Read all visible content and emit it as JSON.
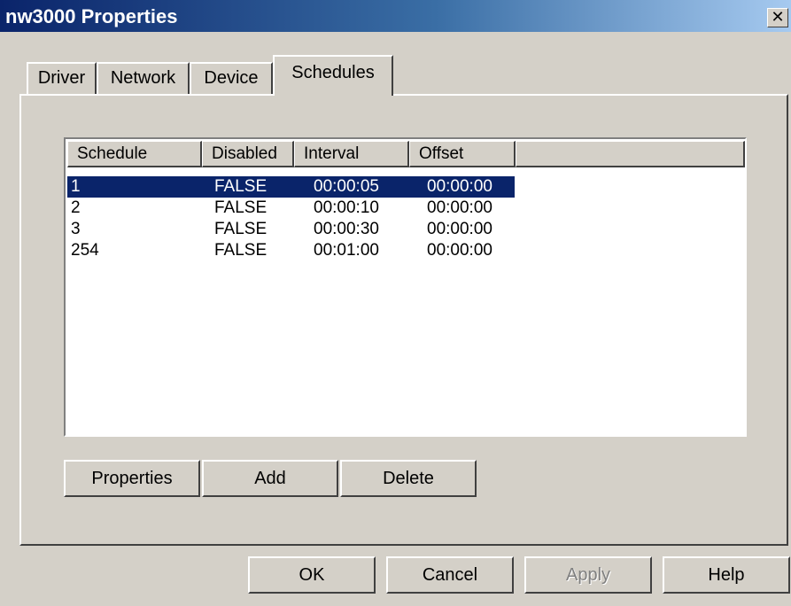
{
  "window": {
    "title": "nw3000 Properties",
    "close_glyph": "✕"
  },
  "tabs": [
    {
      "label": "Driver",
      "active": false
    },
    {
      "label": "Network",
      "active": false
    },
    {
      "label": "Device",
      "active": false
    },
    {
      "label": "Schedules",
      "active": true
    }
  ],
  "schedules": {
    "columns": [
      "Schedule",
      "Disabled",
      "Interval",
      "Offset"
    ],
    "rows": [
      {
        "schedule": "1",
        "disabled": "FALSE",
        "interval": "00:00:05",
        "offset": "00:00:00",
        "selected": true
      },
      {
        "schedule": "2",
        "disabled": "FALSE",
        "interval": "00:00:10",
        "offset": "00:00:00",
        "selected": false
      },
      {
        "schedule": "3",
        "disabled": "FALSE",
        "interval": "00:00:30",
        "offset": "00:00:00",
        "selected": false
      },
      {
        "schedule": "254",
        "disabled": "FALSE",
        "interval": "00:01:00",
        "offset": "00:00:00",
        "selected": false
      }
    ],
    "buttons": {
      "properties": "Properties",
      "add": "Add",
      "delete": "Delete"
    }
  },
  "dialog_buttons": {
    "ok": "OK",
    "cancel": "Cancel",
    "apply": "Apply",
    "apply_enabled": false,
    "help": "Help"
  },
  "colors": {
    "selection": "#0a246a",
    "face": "#d4d0c8",
    "title_start": "#0a246a",
    "title_end": "#a6caf0"
  }
}
